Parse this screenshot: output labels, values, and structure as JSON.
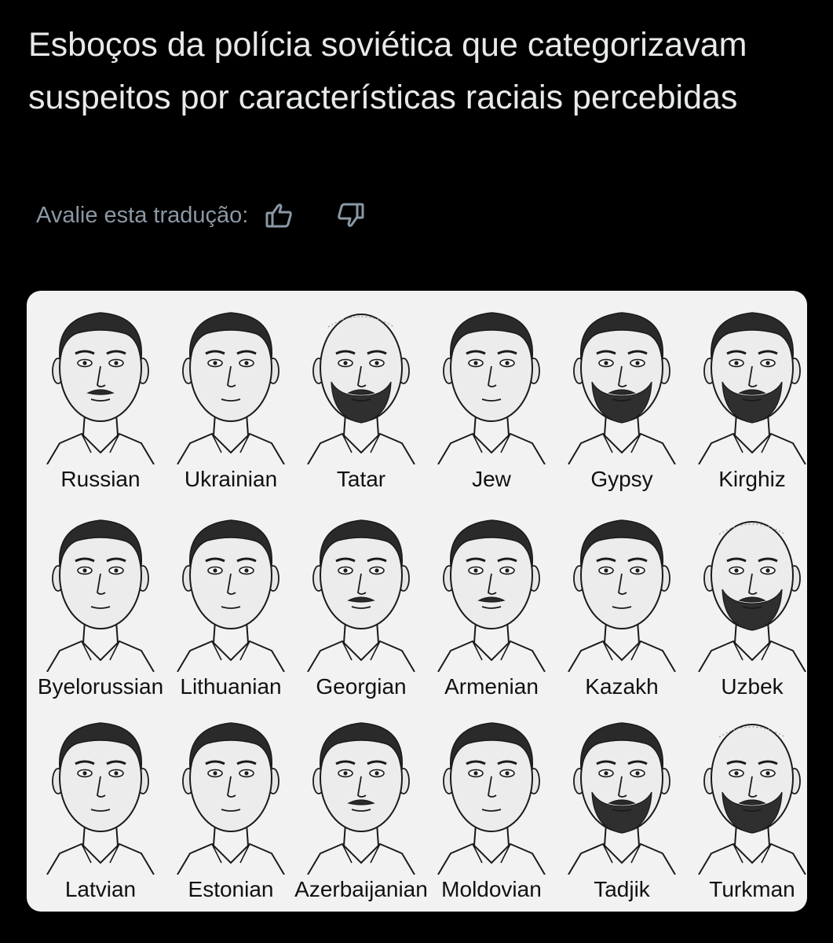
{
  "post": {
    "text": "Esboços da polícia soviética que categorizavam suspeitos por características raciais percebidas"
  },
  "translation_rating": {
    "label": "Avalie esta tradução:",
    "thumbs_up_icon": "thumbs-up-icon",
    "thumbs_down_icon": "thumbs-down-icon"
  },
  "image": {
    "rows": [
      {
        "faces": [
          {
            "label": "Russian",
            "beard": false,
            "mustache": true,
            "bald": false
          },
          {
            "label": "Ukrainian",
            "beard": false,
            "mustache": false,
            "bald": false
          },
          {
            "label": "Tatar",
            "beard": true,
            "mustache": true,
            "bald": true
          },
          {
            "label": "Jew",
            "beard": false,
            "mustache": false,
            "bald": false
          },
          {
            "label": "Gypsy",
            "beard": true,
            "mustache": true,
            "bald": false
          },
          {
            "label": "Kirghiz",
            "beard": true,
            "mustache": true,
            "bald": false
          }
        ]
      },
      {
        "faces": [
          {
            "label": "Byelorussian",
            "beard": false,
            "mustache": false,
            "bald": false
          },
          {
            "label": "Lithuanian",
            "beard": false,
            "mustache": false,
            "bald": false
          },
          {
            "label": "Georgian",
            "beard": false,
            "mustache": true,
            "bald": false
          },
          {
            "label": "Armenian",
            "beard": false,
            "mustache": true,
            "bald": false
          },
          {
            "label": "Kazakh",
            "beard": false,
            "mustache": false,
            "bald": false
          },
          {
            "label": "Uzbek",
            "beard": true,
            "mustache": true,
            "bald": true
          }
        ]
      },
      {
        "faces": [
          {
            "label": "Latvian",
            "beard": false,
            "mustache": false,
            "bald": false
          },
          {
            "label": "Estonian",
            "beard": false,
            "mustache": false,
            "bald": false
          },
          {
            "label": "Azerbaijanian",
            "beard": false,
            "mustache": true,
            "bald": false
          },
          {
            "label": "Moldovian",
            "beard": false,
            "mustache": false,
            "bald": false
          },
          {
            "label": "Tadjik",
            "beard": true,
            "mustache": true,
            "bald": false
          },
          {
            "label": "Turkman",
            "beard": true,
            "mustache": true,
            "bald": true
          }
        ]
      }
    ]
  }
}
